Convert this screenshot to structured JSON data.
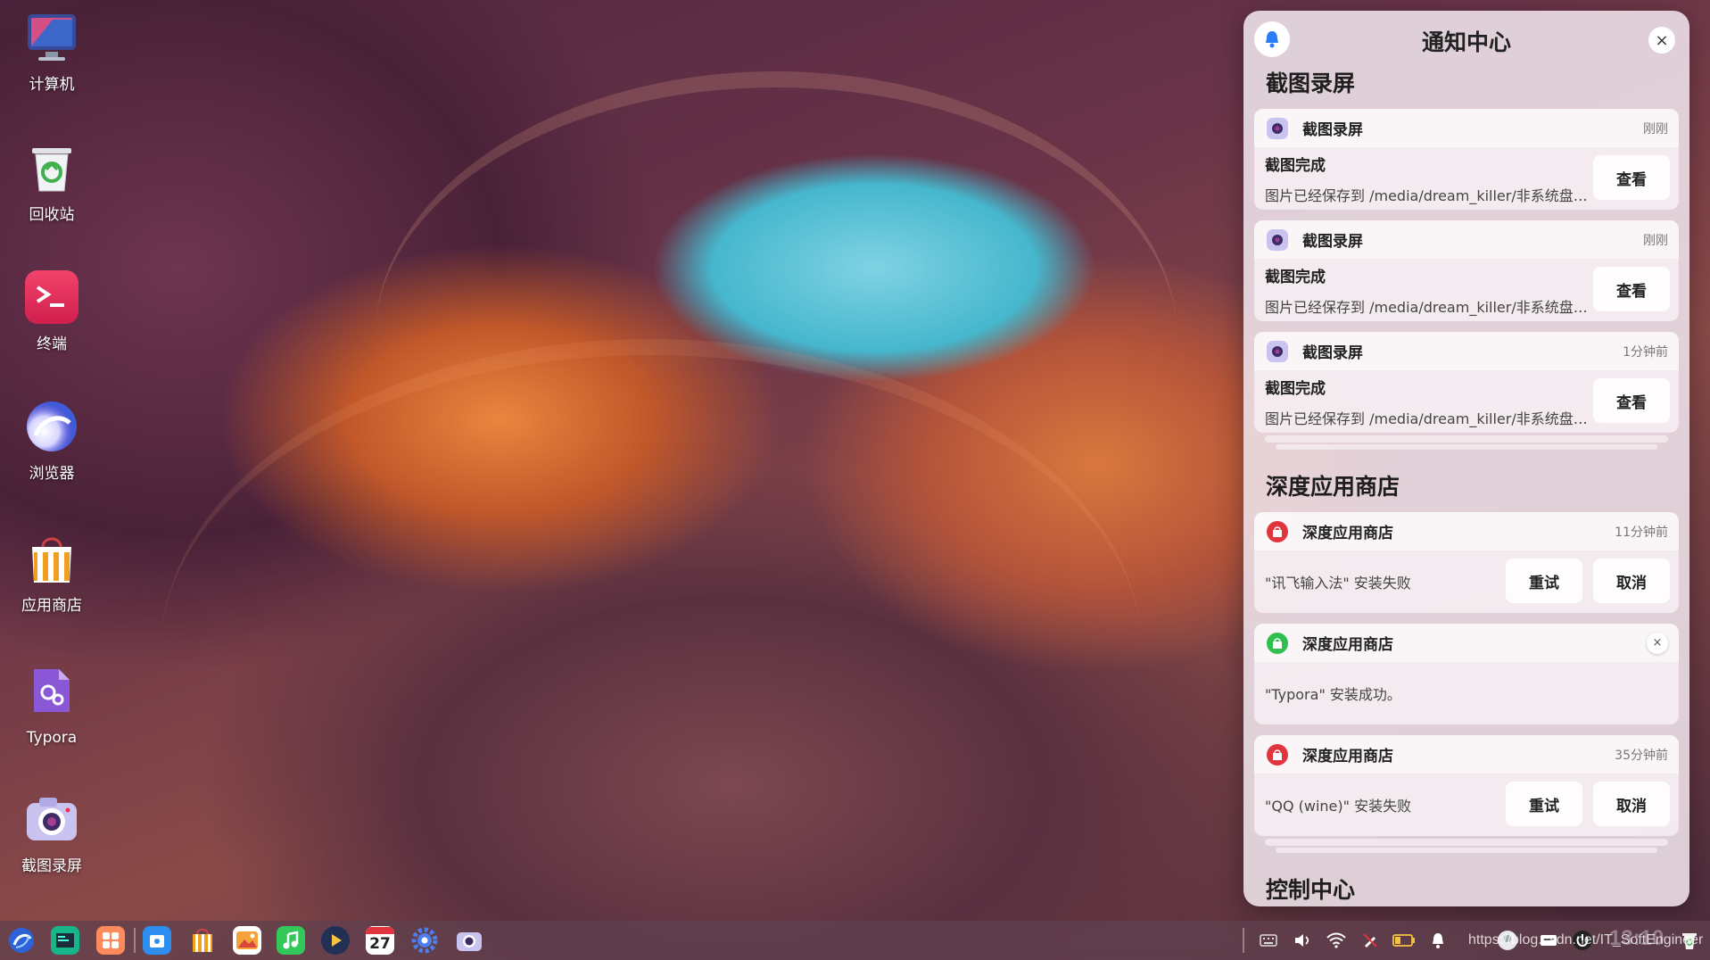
{
  "desktop": {
    "icons": [
      {
        "label": "计算机",
        "icon": "computer-icon"
      },
      {
        "label": "回收站",
        "icon": "trash-icon"
      },
      {
        "label": "终端",
        "icon": "terminal-icon"
      },
      {
        "label": "浏览器",
        "icon": "browser-icon"
      },
      {
        "label": "应用商店",
        "icon": "app-store-icon"
      },
      {
        "label": "Typora",
        "icon": "typora-icon"
      },
      {
        "label": "截图录屏",
        "icon": "screenshot-icon"
      }
    ]
  },
  "notification_center": {
    "title": "通知中心",
    "close_glyph": "×",
    "groups": {
      "screenshot": {
        "title": "截图录屏",
        "items": [
          {
            "app": "截图录屏",
            "time": "刚刚",
            "title": "截图完成",
            "text": "图片已经保存到 /media/dream_killer/非系统盘…",
            "action": "查看"
          },
          {
            "app": "截图录屏",
            "time": "刚刚",
            "title": "截图完成",
            "text": "图片已经保存到 /media/dream_killer/非系统盘…",
            "action": "查看"
          },
          {
            "app": "截图录屏",
            "time": "1分钟前",
            "title": "截图完成",
            "text": "图片已经保存到 /media/dream_killer/非系统盘…",
            "action": "查看"
          }
        ]
      },
      "app_store": {
        "title": "深度应用商店",
        "items": [
          {
            "app": "深度应用商店",
            "time": "11分钟前",
            "text": "\"讯飞输入法\" 安装失败",
            "retry": "重试",
            "cancel": "取消"
          },
          {
            "app": "深度应用商店",
            "close_glyph": "×",
            "text": "\"Typora\" 安装成功。"
          },
          {
            "app": "深度应用商店",
            "time": "35分钟前",
            "text": "\"QQ (wine)\" 安装失败",
            "retry": "重试",
            "cancel": "取消"
          }
        ]
      },
      "control_center": {
        "title": "控制中心"
      }
    }
  },
  "dock": {
    "apps": [
      "launcher-icon",
      "file-manager-icon",
      "multitask-icon",
      "app-finder-icon",
      "app-store-icon",
      "image-viewer-icon",
      "music-icon",
      "video-player-icon",
      "calendar-icon",
      "settings-icon",
      "screenshot-icon"
    ],
    "calendar_day": "27",
    "tray": [
      "keyboard-icon",
      "volume-icon",
      "wifi-icon",
      "pen-icon",
      "battery-icon",
      "notification-icon"
    ],
    "watermark": "https://blog.csdn.net/IT_SoftEngineer",
    "clock": "13:10"
  },
  "colors": {
    "accent": "#2a7cf6",
    "error": "#e0353f",
    "success": "#2fbf4f"
  }
}
